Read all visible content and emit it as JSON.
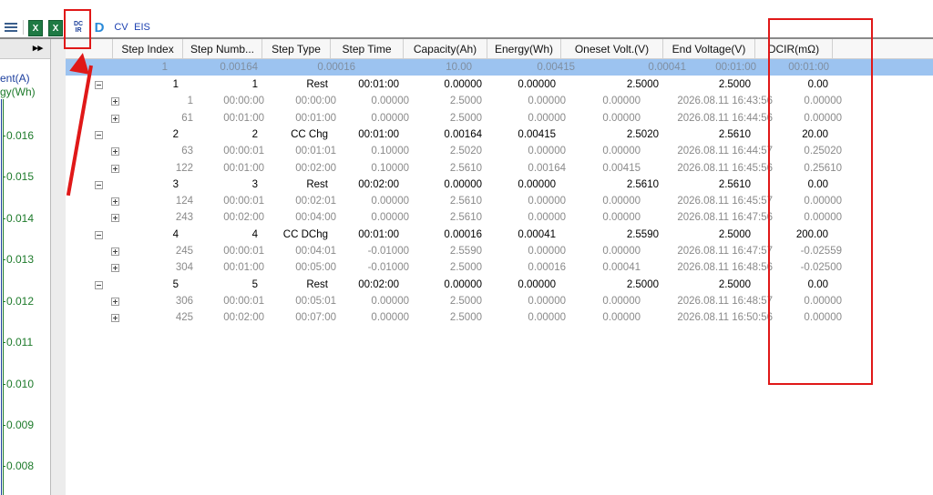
{
  "toolbar": {
    "excel1_icon": "excel-icon",
    "excel1_glyph": "X",
    "excel2_glyph": "X",
    "dcir_line1": "DC",
    "dcir_line2": "IR",
    "d_label": "D",
    "cv_label": "CV",
    "eis_label": "EIS"
  },
  "left_panel": {
    "collapse_glyph": "▸▸",
    "legend_current": "ent(A)",
    "legend_energy": "gy(Wh)",
    "y_ticks": [
      "0.016",
      "0.015",
      "0.014",
      "0.013",
      "0.012",
      "0.011",
      "0.010",
      "0.009",
      "0.008"
    ]
  },
  "grid": {
    "headers": [
      "Step Index",
      "Step Numb...",
      "Step Type",
      "Step Time",
      "Capacity(Ah)",
      "Energy(Wh)",
      "Oneset Volt.(V)",
      "End Voltage(V)",
      "DCIR(mΩ)"
    ],
    "selected_row": [
      "1",
      "0.00164",
      "0.00016",
      "10.00",
      "0.00415",
      "0.00041",
      "00:01:00",
      "00:01:00"
    ],
    "rows": [
      {
        "type": "step",
        "cells": [
          "1",
          "1",
          "Rest",
          "00:01:00",
          "0.00000",
          "0.00000",
          "2.5000",
          "2.5000",
          "0.00"
        ]
      },
      {
        "type": "rec",
        "cells": [
          "1",
          "00:00:00",
          "00:00:00",
          "0.00000",
          "2.5000",
          "0.00000",
          "0.00000",
          "2026.08.11 16:43:56",
          "0.00000"
        ]
      },
      {
        "type": "rec",
        "cells": [
          "61",
          "00:01:00",
          "00:01:00",
          "0.00000",
          "2.5000",
          "0.00000",
          "0.00000",
          "2026.08.11 16:44:56",
          "0.00000"
        ]
      },
      {
        "type": "step",
        "cells": [
          "2",
          "2",
          "CC Chg",
          "00:01:00",
          "0.00164",
          "0.00415",
          "2.5020",
          "2.5610",
          "20.00"
        ]
      },
      {
        "type": "rec",
        "cells": [
          "63",
          "00:00:01",
          "00:01:01",
          "0.10000",
          "2.5020",
          "0.00000",
          "0.00000",
          "2026.08.11 16:44:57",
          "0.25020"
        ]
      },
      {
        "type": "rec",
        "cells": [
          "122",
          "00:01:00",
          "00:02:00",
          "0.10000",
          "2.5610",
          "0.00164",
          "0.00415",
          "2026.08.11 16:45:56",
          "0.25610"
        ]
      },
      {
        "type": "step",
        "cells": [
          "3",
          "3",
          "Rest",
          "00:02:00",
          "0.00000",
          "0.00000",
          "2.5610",
          "2.5610",
          "0.00"
        ]
      },
      {
        "type": "rec",
        "cells": [
          "124",
          "00:00:01",
          "00:02:01",
          "0.00000",
          "2.5610",
          "0.00000",
          "0.00000",
          "2026.08.11 16:45:57",
          "0.00000"
        ]
      },
      {
        "type": "rec",
        "cells": [
          "243",
          "00:02:00",
          "00:04:00",
          "0.00000",
          "2.5610",
          "0.00000",
          "0.00000",
          "2026.08.11 16:47:56",
          "0.00000"
        ]
      },
      {
        "type": "step",
        "cells": [
          "4",
          "4",
          "CC DChg",
          "00:01:00",
          "0.00016",
          "0.00041",
          "2.5590",
          "2.5000",
          "200.00"
        ]
      },
      {
        "type": "rec",
        "cells": [
          "245",
          "00:00:01",
          "00:04:01",
          "-0.01000",
          "2.5590",
          "0.00000",
          "0.00000",
          "2026.08.11 16:47:57",
          "-0.02559"
        ]
      },
      {
        "type": "rec",
        "cells": [
          "304",
          "00:01:00",
          "00:05:00",
          "-0.01000",
          "2.5000",
          "0.00016",
          "0.00041",
          "2026.08.11 16:48:56",
          "-0.02500"
        ]
      },
      {
        "type": "step",
        "cells": [
          "5",
          "5",
          "Rest",
          "00:02:00",
          "0.00000",
          "0.00000",
          "2.5000",
          "2.5000",
          "0.00"
        ]
      },
      {
        "type": "rec",
        "cells": [
          "306",
          "00:00:01",
          "00:05:01",
          "0.00000",
          "2.5000",
          "0.00000",
          "0.00000",
          "2026.08.11 16:48:57",
          "0.00000"
        ]
      },
      {
        "type": "rec",
        "cells": [
          "425",
          "00:02:00",
          "00:07:00",
          "0.00000",
          "2.5000",
          "0.00000",
          "0.00000",
          "2026.08.11 16:50:56",
          "0.00000"
        ]
      }
    ]
  },
  "annotation": {
    "color": "#e01818"
  }
}
